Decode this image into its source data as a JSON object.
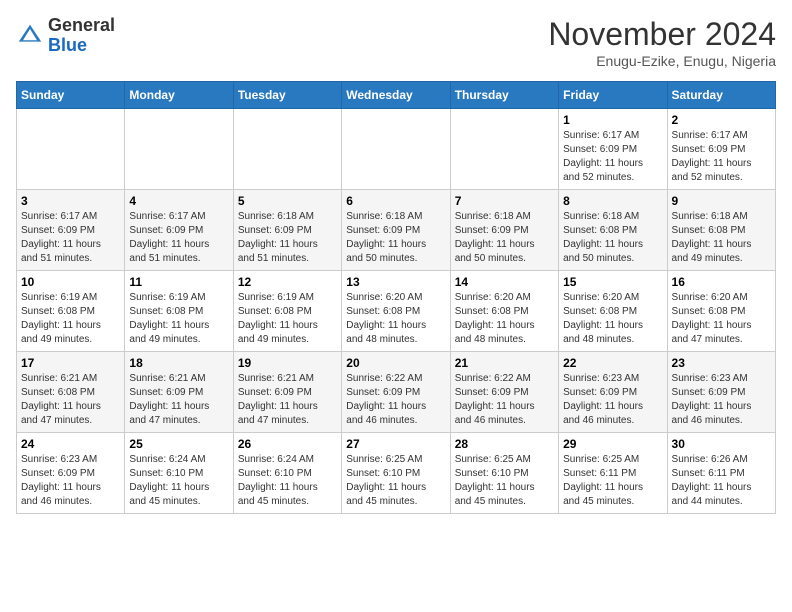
{
  "header": {
    "logo_general": "General",
    "logo_blue": "Blue",
    "month": "November 2024",
    "location": "Enugu-Ezike, Enugu, Nigeria"
  },
  "weekdays": [
    "Sunday",
    "Monday",
    "Tuesday",
    "Wednesday",
    "Thursday",
    "Friday",
    "Saturday"
  ],
  "weeks": [
    [
      {
        "day": "",
        "info": ""
      },
      {
        "day": "",
        "info": ""
      },
      {
        "day": "",
        "info": ""
      },
      {
        "day": "",
        "info": ""
      },
      {
        "day": "",
        "info": ""
      },
      {
        "day": "1",
        "info": "Sunrise: 6:17 AM\nSunset: 6:09 PM\nDaylight: 11 hours\nand 52 minutes."
      },
      {
        "day": "2",
        "info": "Sunrise: 6:17 AM\nSunset: 6:09 PM\nDaylight: 11 hours\nand 52 minutes."
      }
    ],
    [
      {
        "day": "3",
        "info": "Sunrise: 6:17 AM\nSunset: 6:09 PM\nDaylight: 11 hours\nand 51 minutes."
      },
      {
        "day": "4",
        "info": "Sunrise: 6:17 AM\nSunset: 6:09 PM\nDaylight: 11 hours\nand 51 minutes."
      },
      {
        "day": "5",
        "info": "Sunrise: 6:18 AM\nSunset: 6:09 PM\nDaylight: 11 hours\nand 51 minutes."
      },
      {
        "day": "6",
        "info": "Sunrise: 6:18 AM\nSunset: 6:09 PM\nDaylight: 11 hours\nand 50 minutes."
      },
      {
        "day": "7",
        "info": "Sunrise: 6:18 AM\nSunset: 6:09 PM\nDaylight: 11 hours\nand 50 minutes."
      },
      {
        "day": "8",
        "info": "Sunrise: 6:18 AM\nSunset: 6:08 PM\nDaylight: 11 hours\nand 50 minutes."
      },
      {
        "day": "9",
        "info": "Sunrise: 6:18 AM\nSunset: 6:08 PM\nDaylight: 11 hours\nand 49 minutes."
      }
    ],
    [
      {
        "day": "10",
        "info": "Sunrise: 6:19 AM\nSunset: 6:08 PM\nDaylight: 11 hours\nand 49 minutes."
      },
      {
        "day": "11",
        "info": "Sunrise: 6:19 AM\nSunset: 6:08 PM\nDaylight: 11 hours\nand 49 minutes."
      },
      {
        "day": "12",
        "info": "Sunrise: 6:19 AM\nSunset: 6:08 PM\nDaylight: 11 hours\nand 49 minutes."
      },
      {
        "day": "13",
        "info": "Sunrise: 6:20 AM\nSunset: 6:08 PM\nDaylight: 11 hours\nand 48 minutes."
      },
      {
        "day": "14",
        "info": "Sunrise: 6:20 AM\nSunset: 6:08 PM\nDaylight: 11 hours\nand 48 minutes."
      },
      {
        "day": "15",
        "info": "Sunrise: 6:20 AM\nSunset: 6:08 PM\nDaylight: 11 hours\nand 48 minutes."
      },
      {
        "day": "16",
        "info": "Sunrise: 6:20 AM\nSunset: 6:08 PM\nDaylight: 11 hours\nand 47 minutes."
      }
    ],
    [
      {
        "day": "17",
        "info": "Sunrise: 6:21 AM\nSunset: 6:08 PM\nDaylight: 11 hours\nand 47 minutes."
      },
      {
        "day": "18",
        "info": "Sunrise: 6:21 AM\nSunset: 6:09 PM\nDaylight: 11 hours\nand 47 minutes."
      },
      {
        "day": "19",
        "info": "Sunrise: 6:21 AM\nSunset: 6:09 PM\nDaylight: 11 hours\nand 47 minutes."
      },
      {
        "day": "20",
        "info": "Sunrise: 6:22 AM\nSunset: 6:09 PM\nDaylight: 11 hours\nand 46 minutes."
      },
      {
        "day": "21",
        "info": "Sunrise: 6:22 AM\nSunset: 6:09 PM\nDaylight: 11 hours\nand 46 minutes."
      },
      {
        "day": "22",
        "info": "Sunrise: 6:23 AM\nSunset: 6:09 PM\nDaylight: 11 hours\nand 46 minutes."
      },
      {
        "day": "23",
        "info": "Sunrise: 6:23 AM\nSunset: 6:09 PM\nDaylight: 11 hours\nand 46 minutes."
      }
    ],
    [
      {
        "day": "24",
        "info": "Sunrise: 6:23 AM\nSunset: 6:09 PM\nDaylight: 11 hours\nand 46 minutes."
      },
      {
        "day": "25",
        "info": "Sunrise: 6:24 AM\nSunset: 6:10 PM\nDaylight: 11 hours\nand 45 minutes."
      },
      {
        "day": "26",
        "info": "Sunrise: 6:24 AM\nSunset: 6:10 PM\nDaylight: 11 hours\nand 45 minutes."
      },
      {
        "day": "27",
        "info": "Sunrise: 6:25 AM\nSunset: 6:10 PM\nDaylight: 11 hours\nand 45 minutes."
      },
      {
        "day": "28",
        "info": "Sunrise: 6:25 AM\nSunset: 6:10 PM\nDaylight: 11 hours\nand 45 minutes."
      },
      {
        "day": "29",
        "info": "Sunrise: 6:25 AM\nSunset: 6:11 PM\nDaylight: 11 hours\nand 45 minutes."
      },
      {
        "day": "30",
        "info": "Sunrise: 6:26 AM\nSunset: 6:11 PM\nDaylight: 11 hours\nand 44 minutes."
      }
    ]
  ]
}
